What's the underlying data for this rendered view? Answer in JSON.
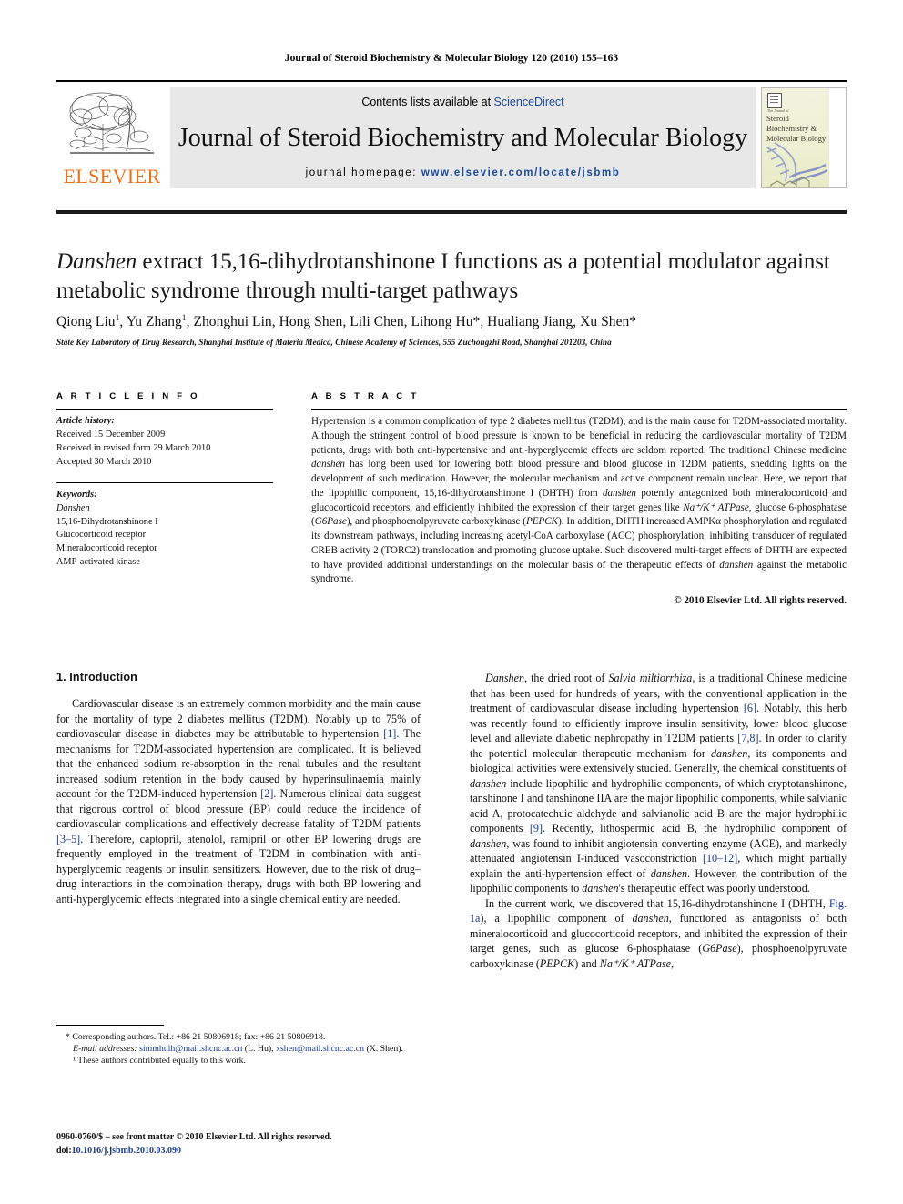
{
  "running_head": "Journal of Steroid Biochemistry & Molecular Biology 120 (2010) 155–163",
  "masthead": {
    "contents_prefix": "Contents lists available at ",
    "sciencedirect": "ScienceDirect",
    "journal_title": "Journal of Steroid Biochemistry and Molecular Biology",
    "homepage_prefix": "journal homepage: ",
    "homepage_url": "www.elsevier.com/locate/jsbmb",
    "publisher_wordmark": "ELSEVIER",
    "cover": {
      "kicker": "The Journal of",
      "title": "Steroid Biochemistry & Molecular Biology"
    },
    "link_color": "#1a4b9c"
  },
  "article": {
    "title_part1_italic": "Danshen",
    "title_rest": " extract 15,16-dihydrotanshinone I functions as a potential modulator against metabolic syndrome through multi-target pathways",
    "authors": "Qiong Liu¹, Yu Zhang¹, Zhonghui Lin, Hong Shen, Lili Chen, Lihong Hu*, Hualiang Jiang, Xu Shen*",
    "affiliation": "State Key Laboratory of Drug Research, Shanghai Institute of Materia Medica, Chinese Academy of Sciences, 555 Zuchongzhi Road, Shanghai 201203, China"
  },
  "article_info": {
    "heading": "A R T I C L E   I N F O",
    "history_label": "Article history:",
    "history": [
      "Received 15 December 2009",
      "Received in revised form 29 March 2010",
      "Accepted 30 March 2010"
    ],
    "keywords_label": "Keywords:",
    "keywords": [
      "Danshen",
      "15,16-Dihydrotanshinone I",
      "Glucocorticoid receptor",
      "Mineralocorticoid receptor",
      "AMP-activated kinase"
    ]
  },
  "abstract": {
    "heading": "A B S T R A C T",
    "text": "Hypertension is a common complication of type 2 diabetes mellitus (T2DM), and is the main cause for T2DM-associated mortality. Although the stringent control of blood pressure is known to be beneficial in reducing the cardiovascular mortality of T2DM patients, drugs with both anti-hypertensive and anti-hyperglycemic effects are seldom reported. The traditional Chinese medicine danshen has long been used for lowering both blood pressure and blood glucose in T2DM patients, shedding lights on the development of such medication. However, the molecular mechanism and active component remain unclear. Here, we report that the lipophilic component, 15,16-dihydrotanshinone I (DHTH) from danshen potently antagonized both mineralocorticoid and glucocorticoid receptors, and efficiently inhibited the expression of their target genes like Na⁺/K⁺ ATPase, glucose 6-phosphatase (G6Pase), and phosphoenolpyruvate carboxykinase (PEPCK). In addition, DHTH increased AMPKα phosphorylation and regulated its downstream pathways, including increasing acetyl-CoA carboxylase (ACC) phosphorylation, inhibiting transducer of regulated CREB activity 2 (TORC2) translocation and promoting glucose uptake. Such discovered multi-target effects of DHTH are expected to have provided additional understandings on the molecular basis of the therapeutic effects of danshen against the metabolic syndrome.",
    "copyright": "© 2010 Elsevier Ltd. All rights reserved."
  },
  "body": {
    "section_number_title": "1.  Introduction",
    "left_paragraphs": [
      "Cardiovascular disease is an extremely common morbidity and the main cause for the mortality of type 2 diabetes mellitus (T2DM). Notably up to 75% of cardiovascular disease in diabetes may be attributable to hypertension [1]. The mechanisms for T2DM-associated hypertension are complicated. It is believed that the enhanced sodium re-absorption in the renal tubules and the resultant increased sodium retention in the body caused by hyperinsulinaemia mainly account for the T2DM-induced hypertension [2]. Numerous clinical data suggest that rigorous control of blood pressure (BP) could reduce the incidence of cardiovascular complications and effectively decrease fatality of T2DM patients [3–5]. Therefore, captopril, atenolol, ramipril or other BP lowering drugs are frequently employed in the treatment of T2DM in combination with anti-hyperglycemic reagents or insulin sensitizers. However, due to the risk of drug–drug interactions in the combination therapy, drugs with both BP lowering and anti-hyperglycemic effects integrated into a single chemical entity are needed."
    ],
    "right_paragraphs": [
      "Danshen, the dried root of Salvia miltiorrhiza, is a traditional Chinese medicine that has been used for hundreds of years, with the conventional application in the treatment of cardiovascular disease including hypertension [6]. Notably, this herb was recently found to efficiently improve insulin sensitivity, lower blood glucose level and alleviate diabetic nephropathy in T2DM patients [7,8]. In order to clarify the potential molecular therapeutic mechanism for danshen, its components and biological activities were extensively studied. Generally, the chemical constituents of danshen include lipophilic and hydrophilic components, of which cryptotanshinone, tanshinone I and tanshinone IIA are the major lipophilic components, while salvianic acid A, protocatechuic aldehyde and salvianolic acid B are the major hydrophilic components [9]. Recently, lithospermic acid B, the hydrophilic component of danshen, was found to inhibit angiotensin converting enzyme (ACE), and markedly attenuated angiotensin I-induced vasoconstriction [10–12], which might partially explain the anti-hypertension effect of danshen. However, the contribution of the lipophilic components to danshen's therapeutic effect was poorly understood.",
      "In the current work, we discovered that 15,16-dihydrotanshinone I (DHTH, Fig. 1a), a lipophilic component of danshen, functioned as antagonists of both mineralocorticoid and glucocorticoid receptors, and inhibited the expression of their target genes, such as glucose 6-phosphatase (G6Pase), phosphoenolpyruvate carboxykinase (PEPCK) and Na⁺/K⁺ ATPase,"
    ]
  },
  "footnotes": {
    "corresponding": "* Corresponding authors. Tel.: +86 21 50806918; fax: +86 21 50806918.",
    "email_label": "E-mail addresses:",
    "email1": "simmhulh@mail.shcnc.ac.cn",
    "email1_owner": "(L. Hu),",
    "email2": "xshen@mail.shcnc.ac.cn",
    "email2_owner": "(X. Shen).",
    "equal_contrib": "¹  These authors contributed equally to this work.",
    "issn_line": "0960-0760/$ – see front matter © 2010 Elsevier Ltd. All rights reserved.",
    "doi_label": "doi:",
    "doi_value": "10.1016/j.jsbmb.2010.03.090"
  }
}
